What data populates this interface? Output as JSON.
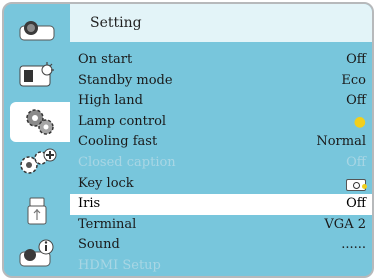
{
  "menu": {
    "title": "Setting",
    "side_icons": [
      {
        "icon": "display-icon",
        "active": false
      },
      {
        "icon": "image-adjust-icon",
        "active": false
      },
      {
        "icon": "setting-gears-icon",
        "active": true
      },
      {
        "icon": "expanded-setting-gears-icon",
        "active": false
      },
      {
        "icon": "usb-memory-icon",
        "active": false
      },
      {
        "icon": "information-icon",
        "active": false
      }
    ],
    "items": [
      {
        "label": "On start",
        "value": "Off",
        "state": "normal"
      },
      {
        "label": "Standby mode",
        "value": "Eco",
        "state": "normal"
      },
      {
        "label": "High land",
        "value": "Off",
        "state": "normal"
      },
      {
        "label": "Lamp control",
        "value": "",
        "icon": "lamp-bulb-icon",
        "state": "normal"
      },
      {
        "label": "Cooling fast",
        "value": "Normal",
        "state": "normal"
      },
      {
        "label": "Closed caption",
        "value": "Off",
        "state": "disabled"
      },
      {
        "label": "Key lock",
        "value": "",
        "icon": "key-lock-icon",
        "state": "normal"
      },
      {
        "label": "Iris",
        "value": "Off",
        "state": "selected"
      },
      {
        "label": "Terminal",
        "value": "VGA 2",
        "state": "normal"
      },
      {
        "label": "Sound",
        "value": "......",
        "state": "normal"
      },
      {
        "label": "HDMI Setup",
        "value": "",
        "state": "disabled"
      }
    ]
  },
  "colors": {
    "menu_background": "#78c6dc",
    "header_background": "#e3f4f8",
    "selected_row": "#ffffff",
    "disabled_text": "#a8d6e4",
    "frame_border": "#b7b9bb",
    "lamp_yellow": "#f1cf1c"
  }
}
